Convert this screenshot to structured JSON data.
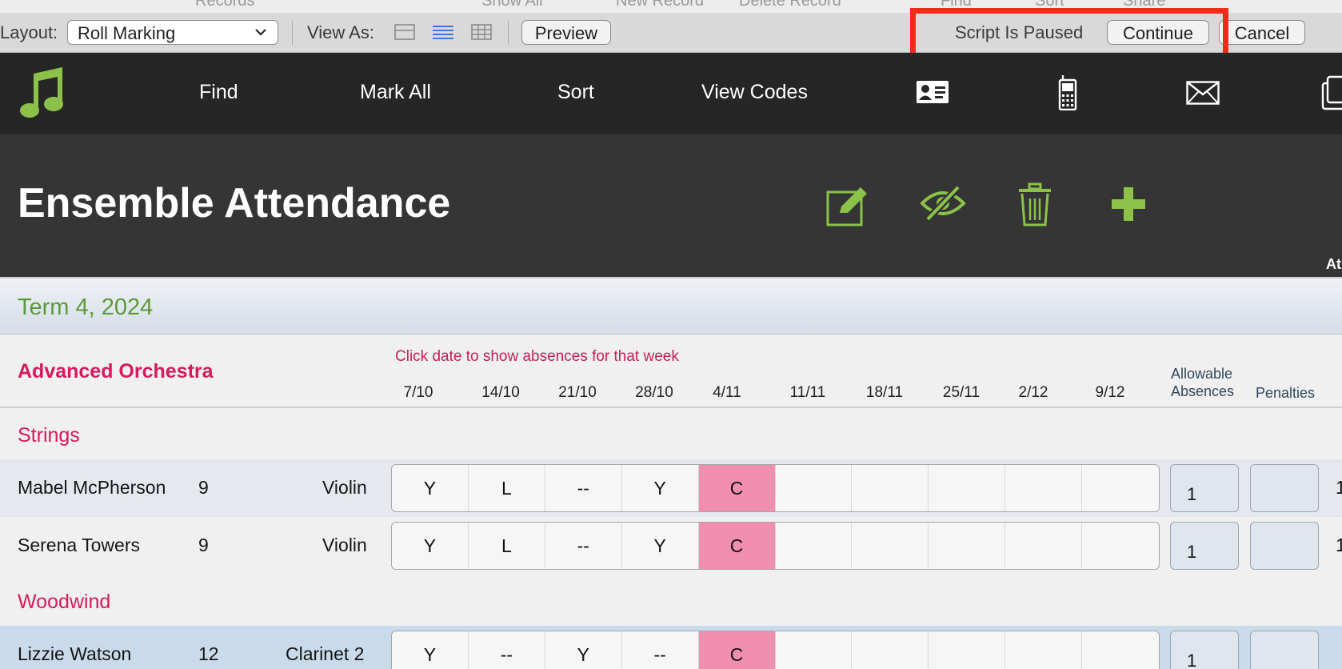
{
  "ghost_toolbar": [
    "Records",
    "Show All",
    "New Record",
    "Delete Record",
    "Find",
    "Sort",
    "Share"
  ],
  "layout_bar": {
    "layout_label": "Layout:",
    "layout_value": "Roll Marking",
    "view_as_label": "View As:",
    "preview_label": "Preview",
    "paused_text": "Script Is Paused",
    "continue_label": "Continue",
    "cancel_label": "Cancel"
  },
  "nav": {
    "items": [
      "Find",
      "Mark All",
      "Sort",
      "View Codes"
    ],
    "icons": [
      "music-note-icon",
      "contact-card-icon",
      "mobile-phone-icon",
      "mail-icon",
      "copy-icon"
    ]
  },
  "header": {
    "title": "Ensemble Attendance",
    "icons": [
      "edit-icon",
      "hide-icon",
      "trash-icon",
      "add-icon"
    ],
    "cut_text": "At"
  },
  "term": {
    "title": "Term 4, 2024"
  },
  "ensemble": {
    "name": "Advanced Orchestra",
    "hint": "Click date to show absences for that week",
    "dates": [
      "7/10",
      "14/10",
      "21/10",
      "28/10",
      "4/11",
      "11/11",
      "18/11",
      "25/11",
      "2/12",
      "9/12"
    ],
    "allowable_line1": "Allowable",
    "allowable_line2": "Absences",
    "penalties": "Penalties"
  },
  "sections": [
    {
      "title": "Strings",
      "rows": [
        {
          "name": "Mabel McPherson",
          "year": "9",
          "instrument": "Violin",
          "marks": [
            "Y",
            "L",
            "--",
            "Y",
            "C",
            "",
            "",
            "",
            "",
            ""
          ],
          "allowable": "1",
          "penalties": "",
          "edge": "1"
        },
        {
          "name": "Serena Towers",
          "year": "9",
          "instrument": "Violin",
          "marks": [
            "Y",
            "L",
            "--",
            "Y",
            "C",
            "",
            "",
            "",
            "",
            ""
          ],
          "allowable": "1",
          "penalties": "",
          "edge": "1"
        }
      ]
    },
    {
      "title": "Woodwind",
      "rows": [
        {
          "name": "Lizzie Watson",
          "year": "12",
          "instrument": "Clarinet 2",
          "marks": [
            "Y",
            "--",
            "Y",
            "--",
            "C",
            "",
            "",
            "",
            "",
            ""
          ],
          "allowable": "1",
          "penalties": "",
          "edge": ""
        }
      ]
    }
  ],
  "colors": {
    "accent_green": "#8cc24a",
    "pink": "#d61a5e",
    "highlight": "#f08fb0",
    "nav_bg": "#262626"
  }
}
